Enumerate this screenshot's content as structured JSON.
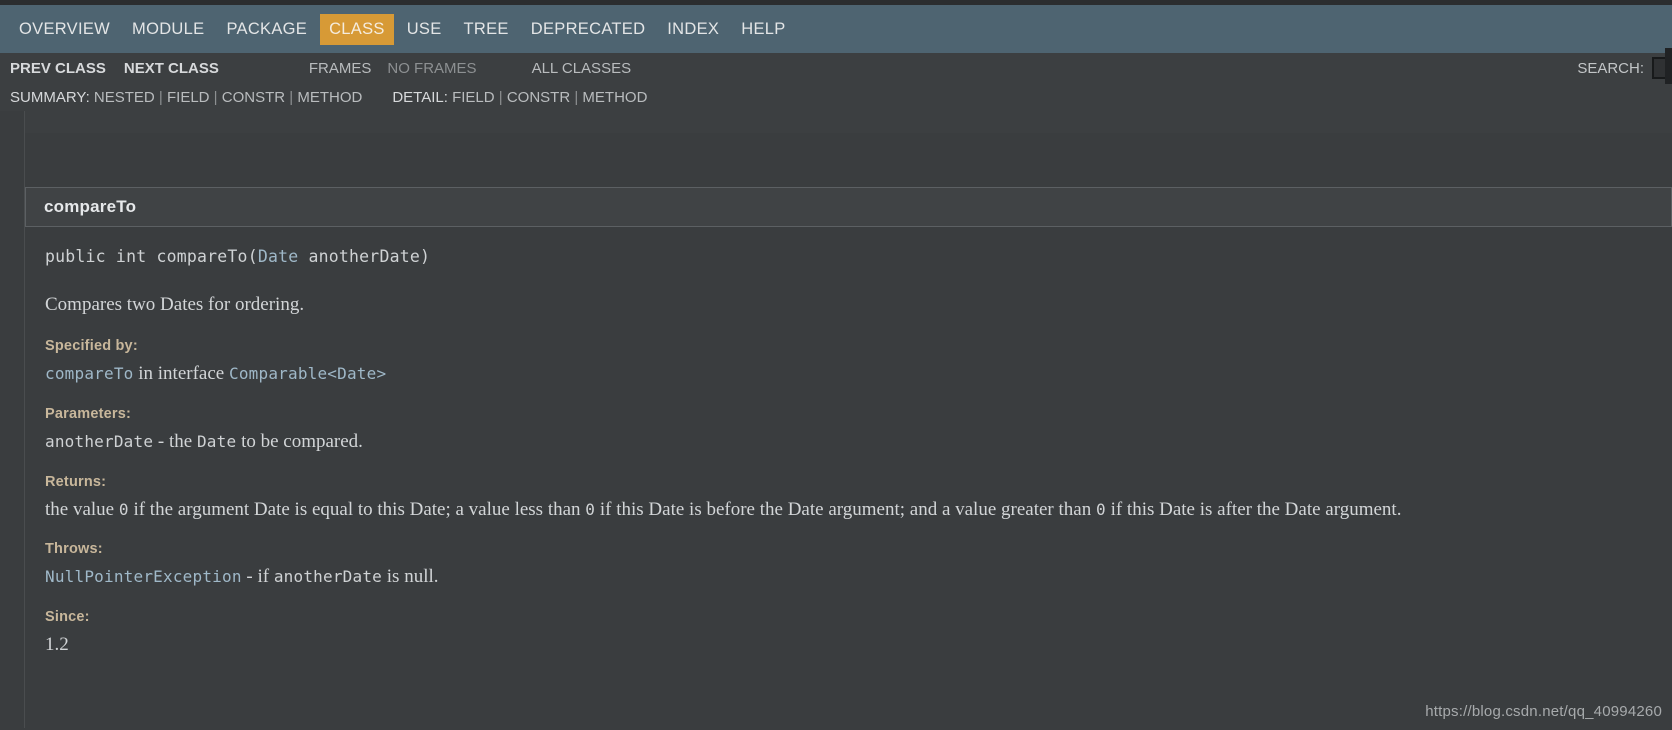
{
  "navbar": {
    "items": [
      {
        "label": "OVERVIEW",
        "active": false
      },
      {
        "label": "MODULE",
        "active": false
      },
      {
        "label": "PACKAGE",
        "active": false
      },
      {
        "label": "CLASS",
        "active": true
      },
      {
        "label": "USE",
        "active": false
      },
      {
        "label": "TREE",
        "active": false
      },
      {
        "label": "DEPRECATED",
        "active": false
      },
      {
        "label": "INDEX",
        "active": false
      },
      {
        "label": "HELP",
        "active": false
      }
    ]
  },
  "subnav": {
    "prev_class": "PREV CLASS",
    "next_class": "NEXT CLASS",
    "frames": "FRAMES",
    "no_frames": "NO FRAMES",
    "all_classes": "ALL CLASSES",
    "search_label": "SEARCH:",
    "search_value": "",
    "summary": {
      "label": "SUMMARY:",
      "items": [
        "NESTED",
        "FIELD",
        "CONSTR",
        "METHOD"
      ]
    },
    "detail": {
      "label": "DETAIL:",
      "items": [
        "FIELD",
        "CONSTR",
        "METHOD"
      ]
    }
  },
  "member": {
    "name": "compareTo",
    "signature": {
      "modifiers": "public int ",
      "method": "compareTo(",
      "param_type": "Date",
      "param_name": " anotherDate)"
    },
    "description": "Compares two Dates for ordering.",
    "specified_by": {
      "label": "Specified by:",
      "method_link": "compareTo",
      "connector": " in interface ",
      "interface_link": "Comparable<Date>"
    },
    "parameters": {
      "label": "Parameters:",
      "name": "anotherDate",
      "dash": " - the ",
      "type": "Date",
      "tail": " to be compared."
    },
    "returns": {
      "label": "Returns:",
      "part1": "the value ",
      "zero1": "0",
      "part2": " if the argument Date is equal to this Date; a value less than ",
      "zero2": "0",
      "part3": " if this Date is before the Date argument; and a value greater than ",
      "zero3": "0",
      "part4": " if this Date is after the Date argument."
    },
    "throws": {
      "label": "Throws:",
      "exception": "NullPointerException",
      "dash": " - if ",
      "param": "anotherDate",
      "tail": " is null."
    },
    "since": {
      "label": "Since:",
      "value": "1.2"
    }
  },
  "watermark": "https://blog.csdn.net/qq_40994260"
}
